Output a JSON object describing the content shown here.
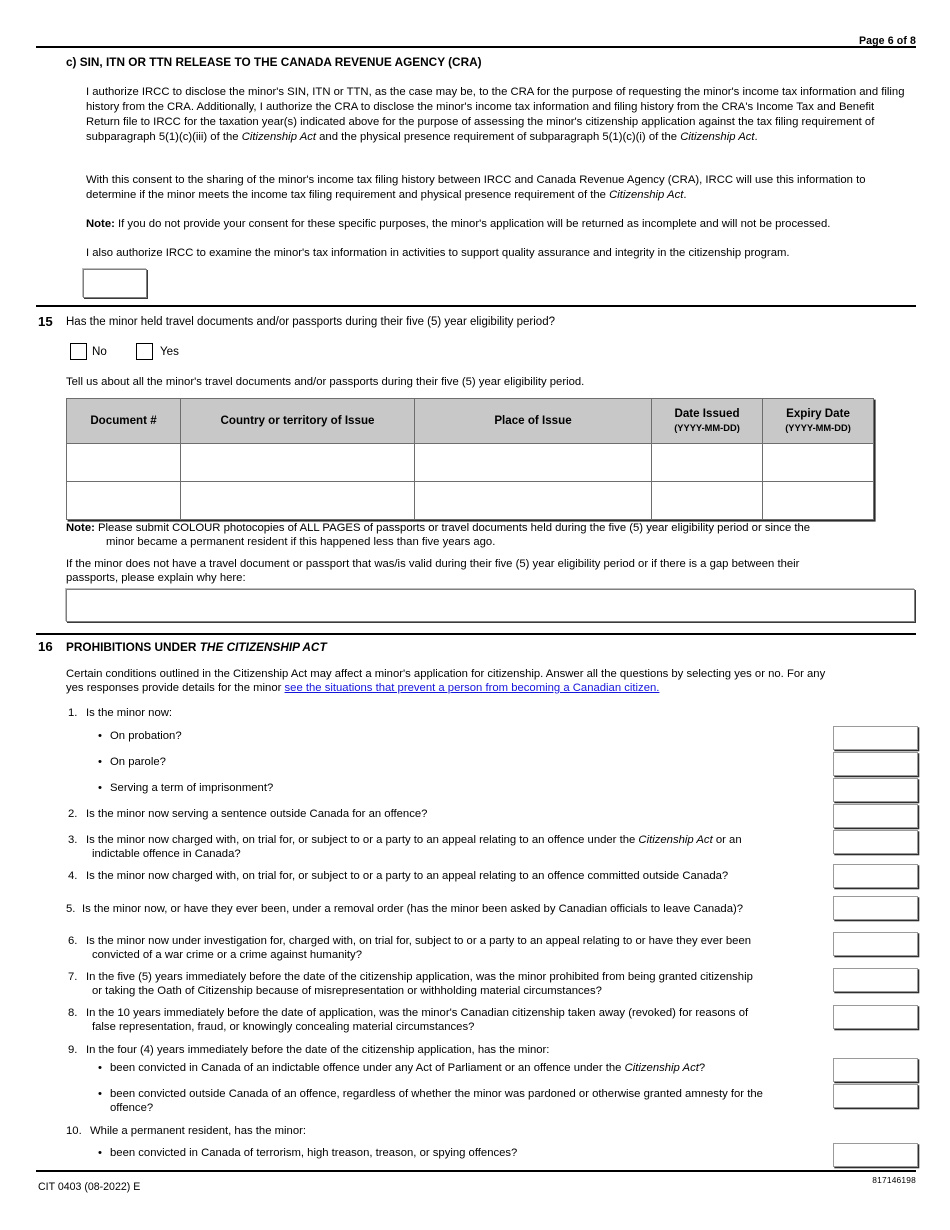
{
  "header": {
    "page_label": "Page 6 of 8"
  },
  "section_c": {
    "heading": "c) SIN, ITN OR TTN RELEASE TO THE CANADA REVENUE AGENCY (CRA)",
    "para1_a": "I authorize IRCC to disclose the minor's SIN, ITN or TTN, as the case may be, to the CRA for the purpose of requesting the minor's income tax information and filing history from the CRA. Additionally, I authorize the CRA to disclose the minor's income tax information and filing history from the CRA's Income Tax and Benefit Return file to IRCC for the taxation year(s) indicated above for the purpose of assessing the minor's citizenship application against the tax filing requirement of subparagraph 5(1)(c)(iii) of the ",
    "para1_italic1": "Citizenship Act",
    "para1_b": " and the physical presence requirement of subparagraph 5(1)(c)(i) of the ",
    "para1_italic2": "Citizenship Act",
    "para1_c": ".",
    "para2_a": "With this consent to the sharing of the minor's income tax filing history between IRCC and Canada Revenue Agency (CRA), IRCC will use this information to determine if the minor meets the income tax filing requirement and physical presence requirement of the ",
    "para2_italic": "Citizenship Act",
    "para2_b": ".",
    "note_label": "Note:",
    "note_text": " If you do not provide your consent for these specific purposes, the minor's application will be returned as incomplete and will not be processed.",
    "para3": "I also authorize IRCC to examine the minor's tax information in activities to support quality assurance and integrity in the citizenship program.",
    "consent_field_value": ""
  },
  "question_15": {
    "number": "15",
    "prompt": "Has the minor held travel documents and/or passports during their five (5) year eligibility period?",
    "option_no": "No",
    "option_yes": "Yes",
    "option_no_checked": false,
    "option_yes_checked": false,
    "instruction": "Tell us about all the minor's travel documents and/or passports during their five (5) year eligibility period.",
    "table": {
      "columns": [
        {
          "title": "Document #",
          "sub": ""
        },
        {
          "title": "Country or territory of Issue",
          "sub": ""
        },
        {
          "title": "Place of Issue",
          "sub": ""
        },
        {
          "title": "Date Issued",
          "sub": "(YYYY-MM-DD)"
        },
        {
          "title": "Expiry Date",
          "sub": "(YYYY-MM-DD)"
        }
      ],
      "rows": [
        [
          "",
          "",
          "",
          "",
          ""
        ],
        [
          "",
          "",
          "",
          "",
          ""
        ]
      ]
    },
    "note_label": "Note:",
    "note_line1": " Please submit COLOUR photocopies of ALL PAGES of passports or travel documents held during the five (5) year eligibility period or since the",
    "note_line2": "minor became a permanent resident if this happened less than five years ago.",
    "explain_line1": "If the minor does not have a travel document or passport that was/is valid during their five (5) year eligibility period or if there is a gap between their",
    "explain_line2": "passports, please explain why here:",
    "explain_value": ""
  },
  "question_16": {
    "number": "16",
    "heading_plain": "PROHIBITIONS UNDER ",
    "heading_italic": "THE CITIZENSHIP ACT",
    "intro_line1": "Certain conditions outlined in the Citizenship Act may affect a minor's application for citizenship.  Answer all the questions by selecting yes or no.  For any",
    "intro_line2_a": "yes responses provide details for the minor  ",
    "intro_link": "see the situations that prevent a person from becoming a Canadian citizen.",
    "items": [
      {
        "id": "q1",
        "number": "1.",
        "text": "Is the minor now:",
        "has_answer": false,
        "sub_items": [
          {
            "id": "q1a",
            "text": "On probation?",
            "answer": ""
          },
          {
            "id": "q1b",
            "text": "On parole?",
            "answer": ""
          },
          {
            "id": "q1c",
            "text": "Serving a term of imprisonment?",
            "answer": ""
          }
        ]
      },
      {
        "id": "q2",
        "number": "2.",
        "text": "Is the minor now serving a sentence outside Canada for an offence?",
        "has_answer": true,
        "answer": ""
      },
      {
        "id": "q3",
        "number": "3.",
        "line1_a": "Is the minor now charged with, on trial for, or subject to or a party to an appeal relating to an offence under the ",
        "line1_italic": "Citizenship Act",
        "line1_b": " or an",
        "line2": "indictable offence in Canada?",
        "has_answer": true,
        "answer": ""
      },
      {
        "id": "q4",
        "number": "4.",
        "text": "Is the minor now charged with, on trial for, or subject to or a party to an appeal relating to an offence committed outside Canada?",
        "has_answer": true,
        "answer": ""
      },
      {
        "id": "q5",
        "number": "5.",
        "text": "Is the minor now, or have they ever been, under a removal order (has the minor been asked by Canadian officials to leave Canada)?",
        "has_answer": true,
        "answer": ""
      },
      {
        "id": "q6",
        "number": "6.",
        "line1": "Is the minor now under investigation for, charged with, on trial for, subject to or a party to an appeal relating to or have they ever been",
        "line2": "convicted of a war crime or a crime against humanity?",
        "has_answer": true,
        "answer": ""
      },
      {
        "id": "q7",
        "number": "7.",
        "line1": "In the five (5) years immediately before the date of the citizenship application, was the minor prohibited from being granted citizenship",
        "line2": "or taking the Oath of Citizenship because of misrepresentation or withholding material circumstances?",
        "has_answer": true,
        "answer": ""
      },
      {
        "id": "q8",
        "number": "8.",
        "line1": "In the 10 years immediately before the date of application, was the minor's Canadian citizenship taken away (revoked) for reasons of",
        "line2": "false representation, fraud, or knowingly concealing material circumstances?",
        "has_answer": true,
        "answer": ""
      },
      {
        "id": "q9",
        "number": "9.",
        "text": "In the four (4) years immediately before the date of the citizenship application, has the minor:",
        "has_answer": false,
        "sub_items": [
          {
            "id": "q9a",
            "text_a": "been convicted in Canada of an indictable offence under any Act of Parliament or an offence under the ",
            "text_italic": "Citizenship Act",
            "text_b": "?",
            "answer": ""
          },
          {
            "id": "q9b",
            "line1": "been convicted outside Canada of an offence, regardless of whether the minor was pardoned or otherwise granted amnesty for the",
            "line2": "offence?",
            "answer": ""
          }
        ]
      },
      {
        "id": "q10",
        "number": "10.",
        "text": "While a permanent resident, has the minor:",
        "has_answer": false,
        "sub_items": [
          {
            "id": "q10a",
            "text": "been convicted in Canada of terrorism, high treason, treason, or spying offences?",
            "answer": ""
          }
        ]
      }
    ]
  },
  "footer": {
    "form_code": "CIT 0403 (08-2022) E",
    "barcode_number": "817146198"
  }
}
